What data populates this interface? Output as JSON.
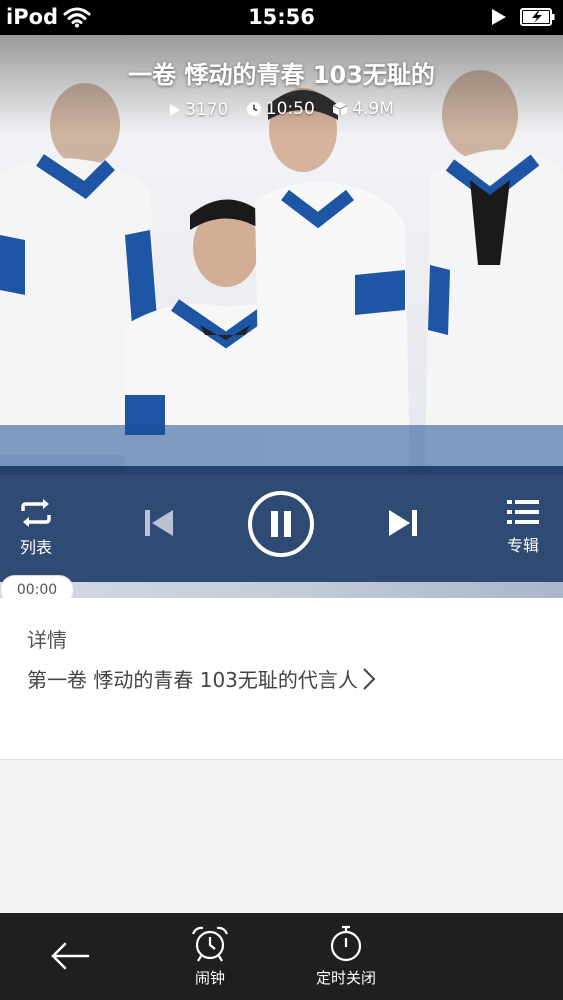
{
  "status_bar": {
    "carrier": "iPod",
    "time": "15:56"
  },
  "player": {
    "title": "一卷 悸动的青春 103无耻的",
    "plays": "3170",
    "duration": "10:50",
    "size": "4.9M",
    "list_label": "列表",
    "album_label": "专辑",
    "current_time": "00:00",
    "is_playing": true
  },
  "details": {
    "heading": "详情",
    "link_text": "第一卷 悸动的青春 103无耻的代言人"
  },
  "bottom_bar": {
    "alarm_label": "闹钟",
    "timer_label": "定时关闭"
  },
  "colors": {
    "control_bar": "#163662",
    "status_bar": "#000000",
    "bottom_bar": "#1f1f1f"
  }
}
